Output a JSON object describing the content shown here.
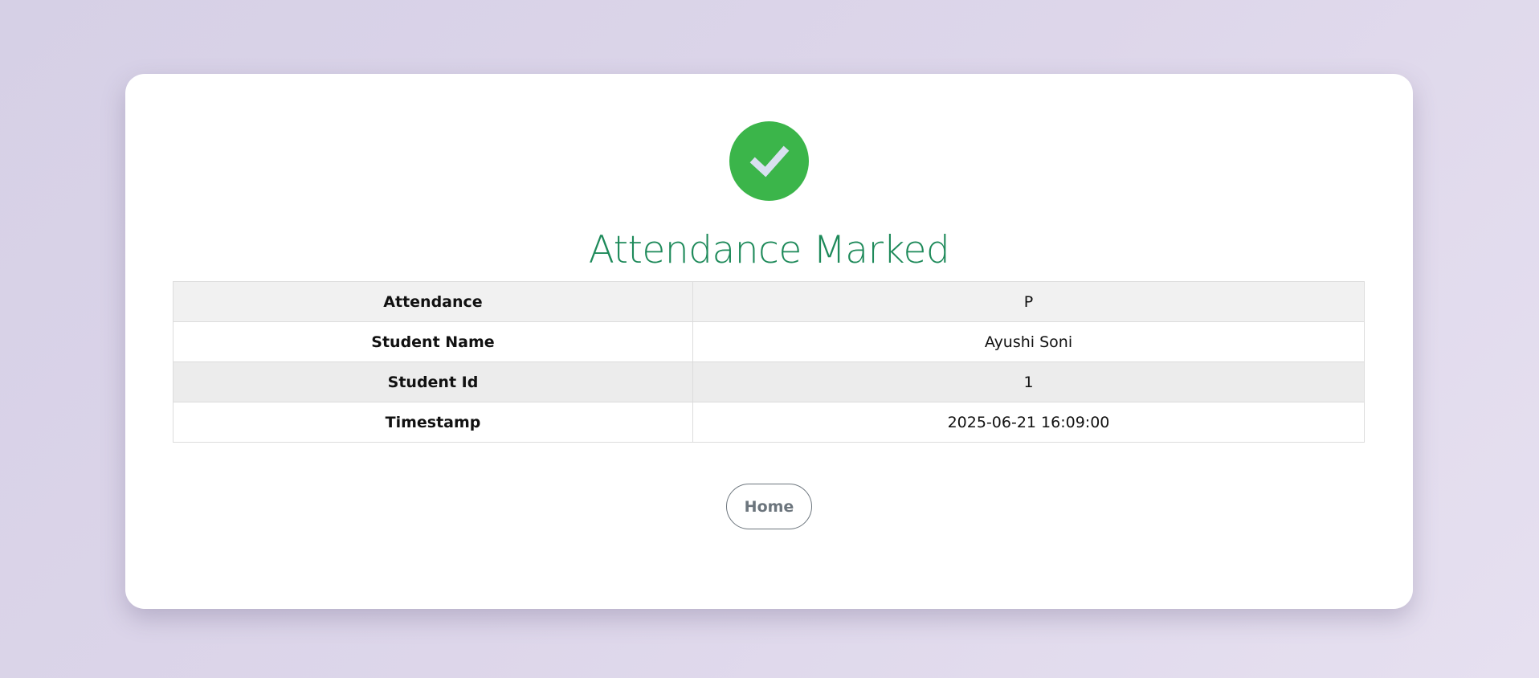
{
  "status": {
    "icon": "check-icon",
    "icon_bg_color": "#3bb54a",
    "icon_mark_color": "#d8e0f0",
    "title": "Attendance Marked",
    "title_color": "#1e8a5a"
  },
  "details": [
    {
      "label": "Attendance",
      "value": "P"
    },
    {
      "label": "Student Name",
      "value": "Ayushi Soni"
    },
    {
      "label": "Student Id",
      "value": "1"
    },
    {
      "label": "Timestamp",
      "value": "2025-06-21 16:09:00"
    }
  ],
  "actions": {
    "home_label": "Home"
  }
}
